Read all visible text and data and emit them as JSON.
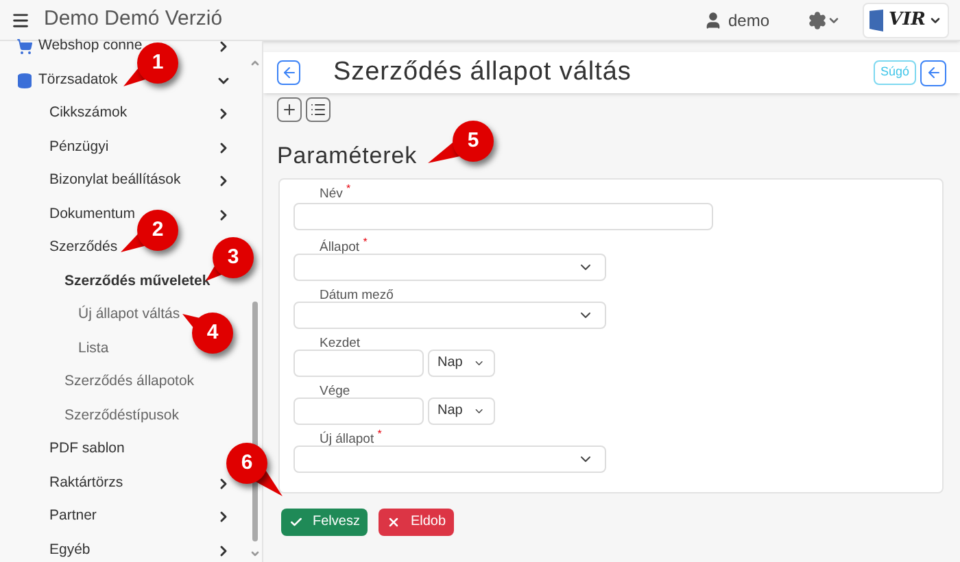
{
  "header": {
    "title": "Demo Demó Verzió",
    "user": "demo",
    "logo_text": "VIR"
  },
  "sidebar": {
    "items": [
      {
        "label": "Webshop conne",
        "kind": "cart",
        "expanded": false
      },
      {
        "label": "Törzsadatok",
        "kind": "database",
        "expanded": true,
        "children": [
          {
            "label": "Cikkszámok",
            "expanded": false
          },
          {
            "label": "Pénzügyi",
            "expanded": false
          },
          {
            "label": "Bizonylat beállítások",
            "expanded": false
          },
          {
            "label": "Dokumentum",
            "expanded": false
          },
          {
            "label": "Szerződés",
            "children": [
              {
                "label": "Szerződés műveletek",
                "selected": true,
                "children": [
                  {
                    "label": "Új állapot váltás",
                    "selected": false
                  },
                  {
                    "label": "Lista",
                    "selected": false
                  }
                ]
              },
              {
                "label": "Szerződés állapotok",
                "selected": false
              },
              {
                "label": "Szerződéstípusok",
                "selected": false
              }
            ]
          },
          {
            "label": "PDF sablon"
          },
          {
            "label": "Raktártörzs",
            "expanded": false
          },
          {
            "label": "Partner",
            "expanded": false
          },
          {
            "label": "Egyéb",
            "expanded": false
          }
        ]
      }
    ]
  },
  "page": {
    "title": "Szerződés állapot váltás",
    "help_button": "Súgó",
    "section_title": "Paraméterek"
  },
  "form": {
    "fields": [
      {
        "label": "Név $^{*}$",
        "kind": "text"
      },
      {
        "label": "Állapot $^{*}$",
        "kind": "select"
      },
      {
        "label": "Dátum mező",
        "kind": "select"
      },
      {
        "label": "Kezdet",
        "kind": "number_unit",
        "unit": "Nap"
      },
      {
        "label": "Vége",
        "kind": "number_unit",
        "unit": "Nap"
      },
      {
        "label": "Új állapot $^{*}$",
        "kind": "select"
      }
    ]
  },
  "buttons": [
    {
      "label": "Felvesz",
      "kind": "save"
    },
    {
      "label": "Eldob",
      "kind": "discard"
    }
  ],
  "callouts": [
    {
      "label": "1"
    },
    {
      "label": "2"
    },
    {
      "label": "3"
    },
    {
      "label": "4"
    },
    {
      "label": "5"
    },
    {
      "label": "6"
    }
  ]
}
